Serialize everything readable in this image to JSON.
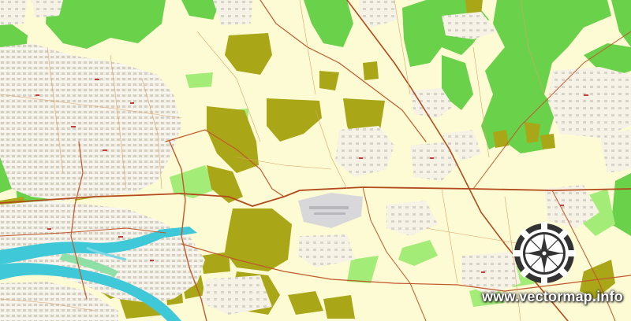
{
  "map": {
    "watermark_text": "www.vectormap.info",
    "logo_icon": "compass-gear-icon",
    "colors": {
      "background": "#fdfbd3",
      "forest": "#6ad14a",
      "farmland": "#a9a718",
      "urban": "#c8c8c8",
      "water": "#3fc8d8",
      "light_green": "#9ee870",
      "road_major": "#c0592c"
    }
  }
}
